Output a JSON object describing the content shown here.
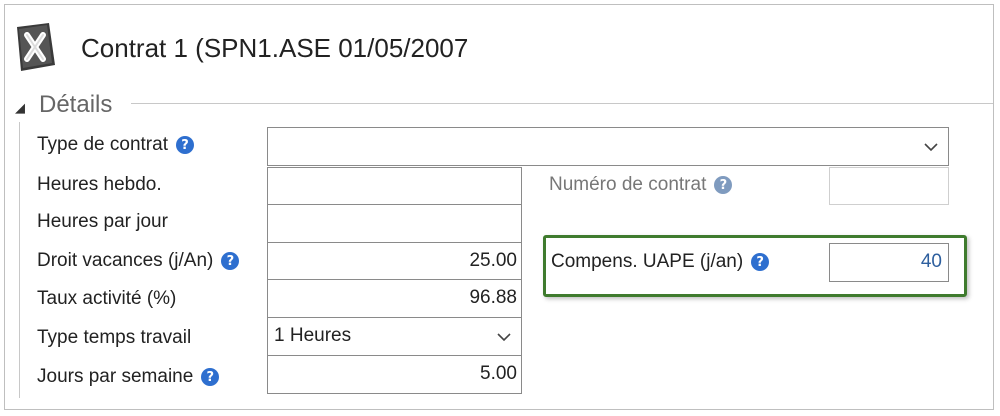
{
  "window": {
    "title": "Contrat 1 (SPN1.ASE 01/05/2007",
    "icon": "app-x-icon"
  },
  "section": {
    "title": "Détails",
    "toggle_glyph": "◢"
  },
  "help_glyph": "?",
  "fields": {
    "type_contrat": {
      "label": "Type de contrat",
      "value": ""
    },
    "heures_hebdo": {
      "label": "Heures hebdo.",
      "value": ""
    },
    "heures_jour": {
      "label": "Heures par jour",
      "value": ""
    },
    "droit_vacances": {
      "label": "Droit vacances (j/An)",
      "value": "25.00"
    },
    "taux_activite": {
      "label": "Taux activité (%)",
      "value": "96.88"
    },
    "type_temps": {
      "label": "Type temps travail",
      "value": "1 Heures"
    },
    "jours_semaine": {
      "label": "Jours par semaine",
      "value": "5.00"
    },
    "numero_contrat": {
      "label": "Numéro de contrat",
      "value": ""
    },
    "compens_uape": {
      "label": "Compens. UAPE (j/an)",
      "value": "40"
    }
  },
  "colors": {
    "help_blue": "#2e6fcf",
    "highlight_green": "#3f7b2e",
    "value_blue": "#2e5f9e"
  }
}
